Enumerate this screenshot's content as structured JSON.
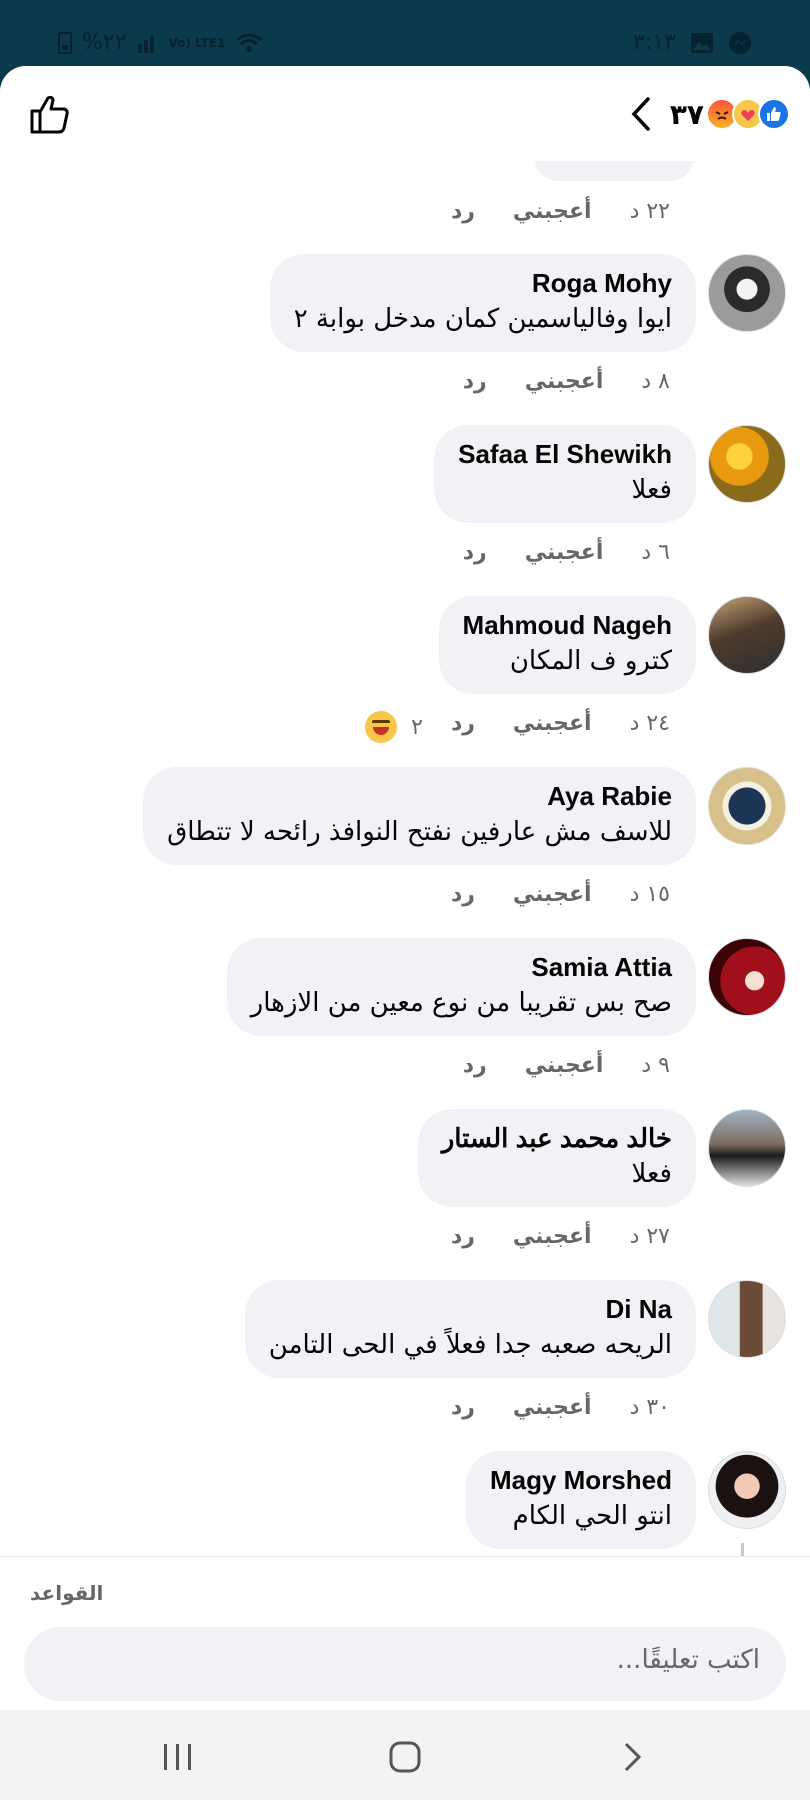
{
  "status_bar": {
    "time": "٣:١٣",
    "battery": "%٢٢",
    "network": "Vo) LTE1"
  },
  "header": {
    "reaction_count": "٣٧",
    "reaction_icons": [
      "angry-icon",
      "care-icon",
      "like-icon"
    ],
    "like_icon": "thumbs-up-outline-icon",
    "back_icon": "chevron-left-icon"
  },
  "prev_comment_meta": {
    "time": "٢٢ د",
    "like": "أعجبني",
    "reply": "رد"
  },
  "comments": [
    {
      "name": "Roga Mohy",
      "text": "ايوا وفالياسمين كمان مدخل بوابة ٢",
      "time": "٨ د",
      "like": "أعجبني",
      "reply": "رد"
    },
    {
      "name": "Safaa El Shewikh",
      "text": "فعلا",
      "time": "٦ د",
      "like": "أعجبني",
      "reply": "رد"
    },
    {
      "name": "Mahmoud Nageh",
      "text": "كترو ف المكان",
      "time": "٢٤ د",
      "like": "أعجبني",
      "reply": "رد",
      "reactions": "٢"
    },
    {
      "name": "Aya Rabie",
      "text": "للاسف مش عارفين نفتح النوافذ رائحه لا تتطاق",
      "time": "١٥ د",
      "like": "أعجبني",
      "reply": "رد"
    },
    {
      "name": "Samia Attia",
      "text": "صح بس تقريبا من نوع معين من الازهار",
      "time": "٩ د",
      "like": "أعجبني",
      "reply": "رد"
    },
    {
      "name": "خالد محمد عبد الستار",
      "text": "فعلا",
      "time": "٢٧ د",
      "like": "أعجبني",
      "reply": "رد"
    },
    {
      "name": "Di Na",
      "text": "الريحه صعبه جدا فعلاً في الحى التامن",
      "time": "٣٠ د",
      "like": "أعجبني",
      "reply": "رد"
    },
    {
      "name": "Magy Morshed",
      "text": "انتو الحي الكام"
    }
  ],
  "footer": {
    "rules_label": "القواعد",
    "comment_placeholder": "اكتب تعليقًا..."
  },
  "colors": {
    "status_bar": "#0b3a4d",
    "bubble": "#f0f2f5",
    "meta_text": "#65676b",
    "like_blue": "#1b74e4"
  }
}
